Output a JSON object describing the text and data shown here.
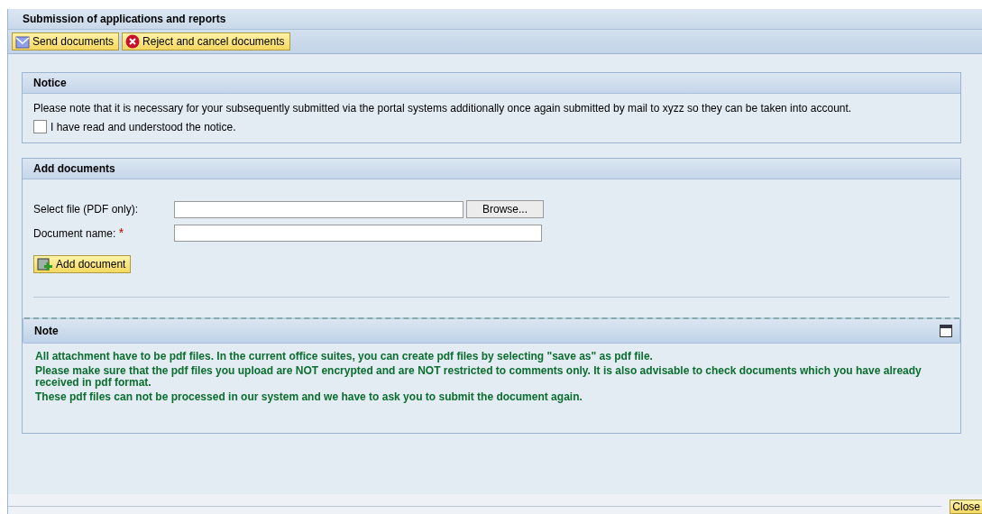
{
  "window": {
    "title": "Submission of applications and reports"
  },
  "toolbar": {
    "buttons": [
      {
        "label": "Send documents",
        "kind": "send"
      },
      {
        "label": "Reject and cancel documents",
        "kind": "reject"
      }
    ]
  },
  "notice": {
    "title": "Notice",
    "text": "Please note that it is necessary for your subsequently submitted via the portal systems additionally once again submitted by mail to xyzz so they can be taken into account.",
    "checkbox": {
      "label": "I have read and understood the notice.",
      "checked": false
    }
  },
  "add_documents": {
    "title": "Add documents",
    "file_label": "Select file (PDF only):",
    "browse_button": "Browse...",
    "name_label": "Document name:",
    "required_mark": "*",
    "add_button": "Add document",
    "note": {
      "title": "Note",
      "expanded": true,
      "paragraphs": [
        "All attachment have to be pdf files. In the current office suites, you can create pdf files by selecting \"save as\" as pdf file.",
        "Please make sure that the pdf files you upload are NOT encrypted and are NOT restricted to comments only. It is also advisable to check documents which you have already received in pdf format.",
        "These pdf files can not be processed in our system and we have to ask you to submit the document again."
      ]
    }
  },
  "footer": {
    "close_button": "Close"
  }
}
